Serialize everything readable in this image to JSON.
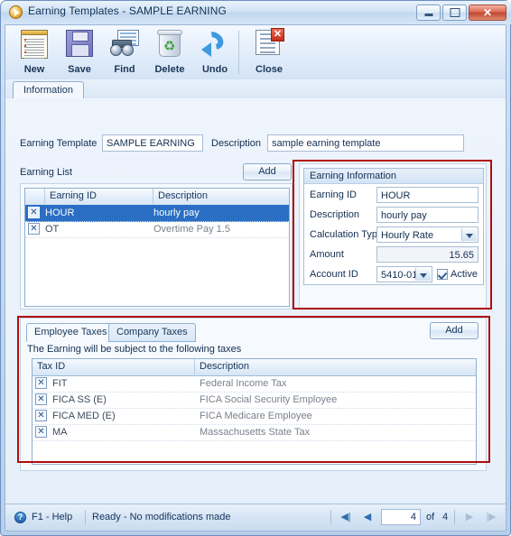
{
  "window": {
    "title": "Earning Templates - SAMPLE EARNING",
    "icon": "play-circle-icon",
    "buttons": {
      "minimize": "minimize-icon",
      "maximize": "maximize-icon",
      "close": "✕"
    }
  },
  "toolbar": {
    "items": [
      {
        "label": "New",
        "icon": "new-document-icon"
      },
      {
        "label": "Save",
        "icon": "floppy-disk-icon"
      },
      {
        "label": "Find",
        "icon": "binoculars-icon"
      },
      {
        "label": "Delete",
        "icon": "recycle-bin-icon"
      },
      {
        "label": "Undo",
        "icon": "undo-arrow-icon"
      },
      {
        "label": "Close",
        "icon": "close-document-icon"
      }
    ]
  },
  "tabs": {
    "main": "Information"
  },
  "form": {
    "earning_template_label": "Earning Template",
    "earning_template_value": "SAMPLE EARNING",
    "description_label": "Description",
    "description_value": "sample earning template"
  },
  "earning_list": {
    "title": "Earning List",
    "add_label": "Add",
    "columns": [
      "Earning ID",
      "Description"
    ],
    "rows": [
      {
        "delete": "✕",
        "id": "HOUR",
        "description": "hourly pay",
        "selected": true
      },
      {
        "delete": "✕",
        "id": "OT",
        "description": "Overtime Pay 1.5",
        "selected": false
      }
    ]
  },
  "earning_information": {
    "title": "Earning Information",
    "fields": {
      "earning_id_label": "Earning ID",
      "earning_id_value": "HOUR",
      "description_label": "Description",
      "description_value": "hourly pay",
      "calculation_type_label": "Calculation Type",
      "calculation_type_value": "Hourly Rate",
      "amount_label": "Amount",
      "amount_value": "15.65",
      "account_id_label": "Account ID",
      "account_id_value": "5410-01",
      "active_label": "Active",
      "active_checked": true
    }
  },
  "taxes": {
    "tab_employee": "Employee Taxes",
    "tab_company": "Company Taxes",
    "add_label": "Add",
    "hint": "The Earning will be subject to the following taxes",
    "columns": [
      "Tax ID",
      "Description"
    ],
    "rows": [
      {
        "delete": "✕",
        "id": "FIT",
        "description": "Federal Income Tax"
      },
      {
        "delete": "✕",
        "id": "FICA SS (E)",
        "description": "FICA Social Security Employee"
      },
      {
        "delete": "✕",
        "id": "FICA MED (E)",
        "description": "FICA Medicare Employee"
      },
      {
        "delete": "✕",
        "id": "MA",
        "description": "Massachusetts State Tax"
      }
    ]
  },
  "statusbar": {
    "help_icon": "question-mark-icon",
    "help_label": "F1 - Help",
    "status": "Ready - No modifications made",
    "nav": {
      "first": "◀|",
      "prev": "◀",
      "current": "4",
      "of_label": "of",
      "total": "4",
      "next": "▶",
      "last": "|▶"
    }
  },
  "colors": {
    "annotation": "#b00d0d",
    "selection": "#2a6fc4",
    "title_text": "#113355"
  }
}
